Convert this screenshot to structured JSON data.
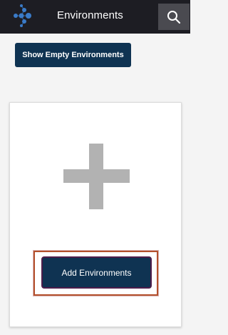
{
  "header": {
    "logo_icon": "network-logo-icon",
    "title": "Environments",
    "search_icon": "search-icon"
  },
  "toolbar": {
    "show_empty_label": "Show Empty Environments"
  },
  "card": {
    "plus_icon": "plus-icon",
    "add_label": "Add Environments"
  },
  "colors": {
    "header_bg": "#1d1d23",
    "button_bg": "#0f3352",
    "search_bg": "#4a4a50",
    "plus_gray": "#b2b2b2",
    "focus_outline": "#b3502c",
    "logo_blue": "#3a7bc8"
  }
}
